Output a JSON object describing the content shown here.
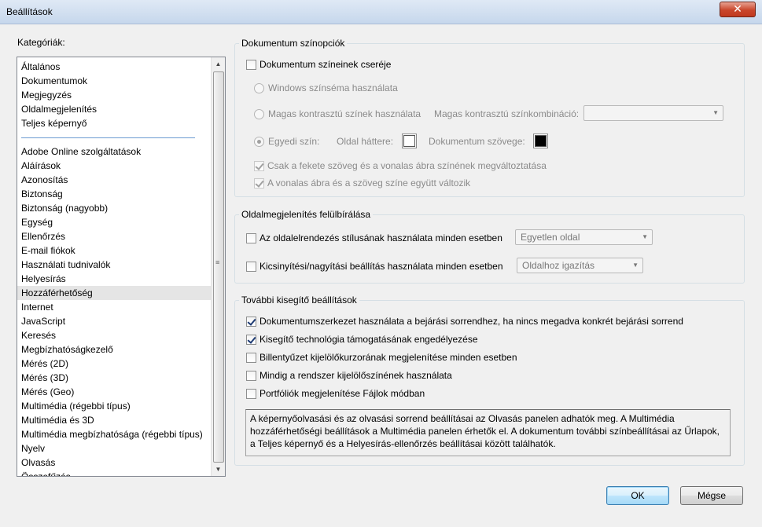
{
  "window": {
    "title": "Beállítások",
    "close_symbol": "✕"
  },
  "categories": {
    "label": "Kategóriák:",
    "top_items": [
      "Általános",
      "Dokumentumok",
      "Megjegyzés",
      "Oldalmegjelenítés",
      "Teljes képernyő"
    ],
    "items": [
      "Adobe Online szolgáltatások",
      "Aláírások",
      "Azonosítás",
      "Biztonság",
      "Biztonság (nagyobb)",
      "Egység",
      "Ellenőrzés",
      "E-mail fiókok",
      "Használati tudnivalók",
      "Helyesírás",
      "Hozzáférhetőség",
      "Internet",
      "JavaScript",
      "Keresés",
      "Megbízhatóságkezelő",
      "Mérés (2D)",
      "Mérés (3D)",
      "Mérés (Geo)",
      "Multimédia (régebbi típus)",
      "Multimédia és 3D",
      "Multimédia megbízhatósága (régebbi típus)",
      "Nyelv",
      "Olvasás",
      "Összefűzés"
    ],
    "selected": "Hozzáférhetőség"
  },
  "doc_colors": {
    "title": "Dokumentum színopciók",
    "replace_label": "Dokumentum színeinek cseréje",
    "windows_scheme_label": "Windows színséma használata",
    "high_contrast_label": "Magas kontrasztú színek használata",
    "high_contrast_combo_label": "Magas kontrasztú színkombináció:",
    "high_contrast_combo_value": "",
    "custom_label": "Egyedi szín:",
    "page_bg_label": "Oldal háttere:",
    "page_bg_color": "#ffffff",
    "doc_text_label": "Dokumentum szövege:",
    "doc_text_color": "#000000",
    "black_text_only_label": "Csak a fekete szöveg és a vonalas ábra színének megváltoztatása",
    "line_art_together_label": "A vonalas ábra és a szöveg színe együtt változik"
  },
  "page_override": {
    "title": "Oldalmegjelenítés felülbírálása",
    "layout_label": "Az oldalelrendezés stílusának használata minden esetben",
    "layout_value": "Egyetlen oldal",
    "zoom_label": "Kicsinyítési/nagyítási beállítás használata minden esetben",
    "zoom_value": "Oldalhoz igazítás"
  },
  "assistive": {
    "title": "További kisegítő beállítások",
    "options": [
      {
        "label": "Dokumentumszerkezet használata a bejárási sorrendhez, ha nincs megadva konkrét bejárási sorrend",
        "checked": true
      },
      {
        "label": "Kisegítő technológia támogatásának engedélyezése",
        "checked": true
      },
      {
        "label": "Billentyűzet kijelölőkurzorának megjelenítése minden esetben",
        "checked": false
      },
      {
        "label": "Mindig a rendszer kijelölőszínének használata",
        "checked": false
      },
      {
        "label": "Portfóliók megjelenítése Fájlok módban",
        "checked": false
      }
    ],
    "info": "A képernyőolvasási és az olvasási sorrend beállításai az Olvasás panelen adhatók meg. A Multimédia hozzáférhetőségi beállítások a Multimédia panelen érhetők el. A dokumentum további színbeállításai az Űrlapok, a Teljes képernyő és a Helyesírás-ellenőrzés beállításai között találhatók."
  },
  "buttons": {
    "ok": "OK",
    "cancel": "Mégse"
  }
}
